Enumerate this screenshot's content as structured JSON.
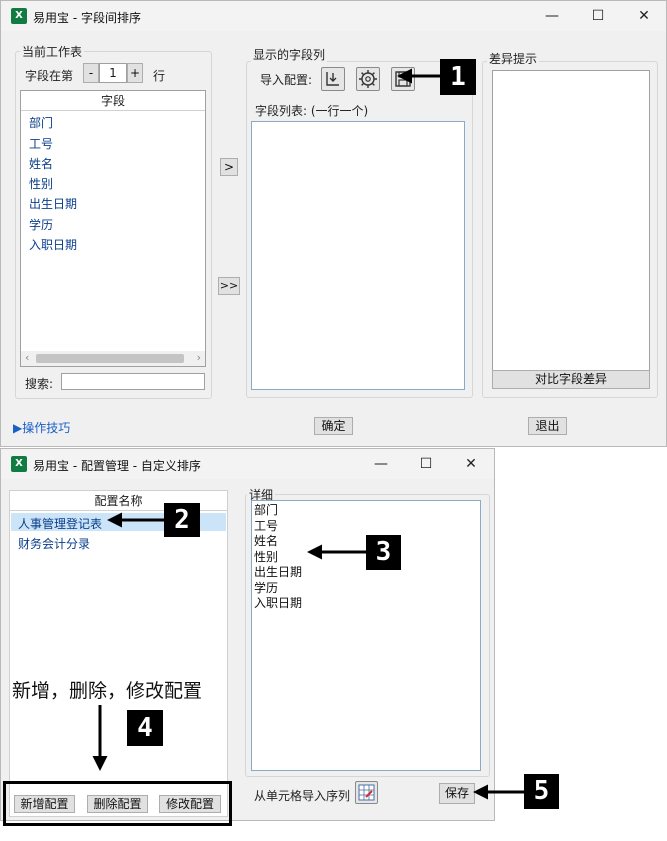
{
  "win1": {
    "title": "易用宝 - 字段间排序",
    "current_sheet": {
      "group_label": "当前工作表",
      "row_prefix": "字段在第",
      "row_value": "1",
      "row_suffix": "行",
      "minus": "-",
      "plus": "+",
      "column_header": "字段",
      "fields": [
        "部门",
        "工号",
        "姓名",
        "性别",
        "出生日期",
        "学历",
        "入职日期"
      ],
      "search_label": "搜索:",
      "search_value": ""
    },
    "move_one": ">",
    "move_all": ">>",
    "display": {
      "group_label": "显示的字段列",
      "import_config_label": "导入配置:",
      "field_list_label": "字段列表: (一行一个)"
    },
    "diff": {
      "group_label": "差异提示",
      "compare_button": "对比字段差异"
    },
    "tips_link": "▶操作技巧",
    "ok_button": "确定",
    "exit_button": "退出"
  },
  "win2": {
    "title": "易用宝 - 配置管理 - 自定义排序",
    "config_header": "配置名称",
    "configs": [
      "人事管理登记表",
      "财务会计分录"
    ],
    "detail_label": "详细",
    "detail_items": [
      "部门",
      "工号",
      "姓名",
      "性别",
      "出生日期",
      "学历",
      "入职日期"
    ],
    "add_button": "新增配置",
    "delete_button": "删除配置",
    "modify_button": "修改配置",
    "import_from_cell_label": "从单元格导入序列",
    "save_button": "保存"
  },
  "annotations": {
    "note_text": "新增，删除，修改配置",
    "badges": [
      "1",
      "2",
      "3",
      "4",
      "5"
    ]
  },
  "icons": {
    "app": "excel-icon",
    "import": "import-icon",
    "settings": "gear-icon",
    "save": "floppy-icon",
    "cell_import": "table-import-icon"
  }
}
